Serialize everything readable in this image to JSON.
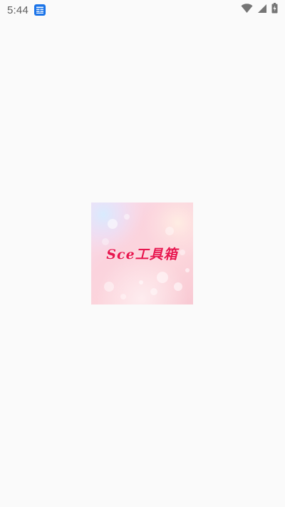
{
  "status_bar": {
    "time": "5:44",
    "notification_icon": "news-app-icon",
    "wifi_icon": "wifi-icon",
    "signal_icon": "cell-signal-icon",
    "battery_icon": "battery-charging-icon"
  },
  "splash": {
    "logo_text": "Sce工具箱",
    "logo_text_color": "#e8174f",
    "background_color": "#fafafa"
  }
}
